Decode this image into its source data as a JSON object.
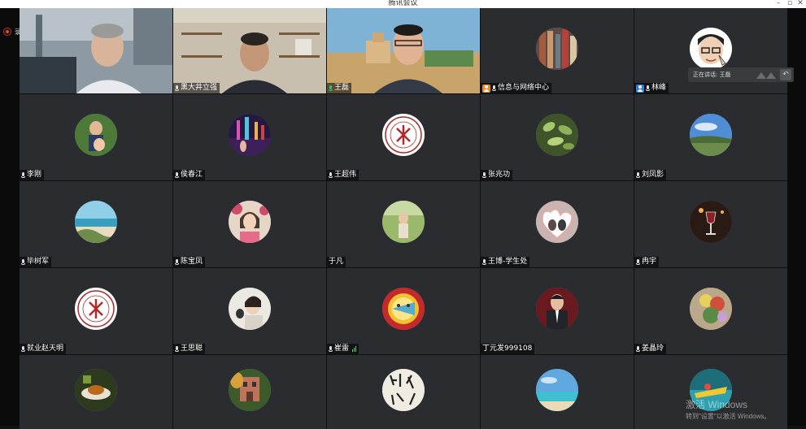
{
  "window": {
    "title": "腾讯会议",
    "minimize": "–",
    "restore": "▫",
    "close": "✕"
  },
  "recording": {
    "label": "录"
  },
  "speaking_now": {
    "label": "正在讲话: 王磊"
  },
  "watermark": {
    "line1": "激活 Windows",
    "line2": "转到\"设置\"以激活 Windows。"
  },
  "colors": {
    "speaking_border": "#1fb98a",
    "tile_bg": "#2b2c2f",
    "badge_orange": "#f08a1c",
    "badge_blue": "#2f7de1"
  },
  "participants": [
    {
      "name": "",
      "kind": "video",
      "speaking": false
    },
    {
      "name": "黑大井立强",
      "kind": "video",
      "mic": "on"
    },
    {
      "name": "王磊",
      "kind": "video",
      "mic": "green",
      "speaking": true
    },
    {
      "name": "信息与网络中心",
      "kind": "avatar",
      "badge": "orange",
      "mic": "on"
    },
    {
      "name": "林峰",
      "kind": "avatar",
      "badge": "blue",
      "mic": "on"
    },
    {
      "name": "李刚",
      "kind": "avatar",
      "mic": "on"
    },
    {
      "name": "侯春江",
      "kind": "avatar",
      "mic": "on"
    },
    {
      "name": "王超伟",
      "kind": "avatar",
      "mic": "on"
    },
    {
      "name": "张兆功",
      "kind": "avatar",
      "mic": "on"
    },
    {
      "name": "刘凤影",
      "kind": "avatar",
      "mic": "on"
    },
    {
      "name": "毕树军",
      "kind": "avatar",
      "mic": "on"
    },
    {
      "name": "陈宝凤",
      "kind": "avatar",
      "mic": "on"
    },
    {
      "name": "于凡",
      "kind": "avatar"
    },
    {
      "name": "王博-学生处",
      "kind": "avatar",
      "mic": "on"
    },
    {
      "name": "冉宇",
      "kind": "avatar",
      "mic": "on"
    },
    {
      "name": "就业赵天明",
      "kind": "avatar",
      "mic": "on"
    },
    {
      "name": "王思聪",
      "kind": "avatar",
      "mic": "on"
    },
    {
      "name": "崔雷",
      "kind": "avatar",
      "mic": "on",
      "signal": true
    },
    {
      "name": "丁元发999108",
      "kind": "avatar"
    },
    {
      "name": "姜晶玲",
      "kind": "avatar",
      "mic": "on"
    },
    {
      "name": "",
      "kind": "avatar"
    },
    {
      "name": "",
      "kind": "avatar"
    },
    {
      "name": "",
      "kind": "avatar"
    },
    {
      "name": "",
      "kind": "avatar"
    },
    {
      "name": "",
      "kind": "avatar"
    }
  ]
}
